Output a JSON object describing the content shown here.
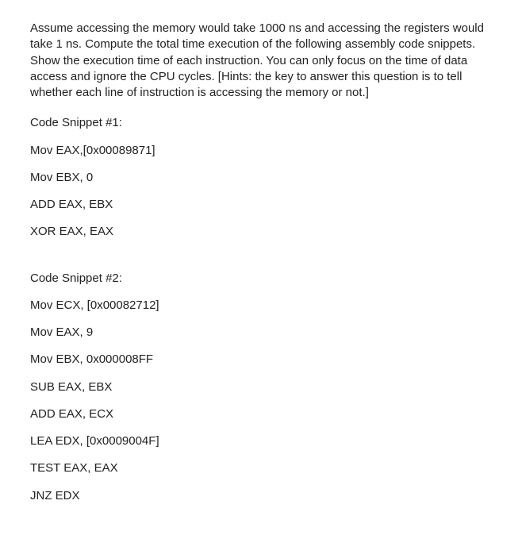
{
  "description": "Assume accessing the memory would take 1000 ns and accessing the registers would take 1 ns. Compute the total time execution of the following assembly code snippets. Show the execution time of each instruction. You can only focus on the time of data access and ignore the CPU cycles. [Hints: the key to answer this question is to tell whether each line of instruction is accessing the memory or not.]",
  "snippet1": {
    "title": "Code Snippet #1:",
    "lines": [
      "Mov EAX,[0x00089871]",
      "Mov EBX, 0",
      "ADD EAX, EBX",
      "XOR EAX, EAX"
    ]
  },
  "snippet2": {
    "title": "Code Snippet #2:",
    "lines": [
      "Mov ECX, [0x00082712]",
      "Mov EAX, 9",
      "Mov EBX, 0x000008FF",
      "SUB EAX, EBX",
      "ADD EAX, ECX",
      "LEA EDX, [0x0009004F]",
      "TEST EAX, EAX",
      "JNZ EDX"
    ]
  }
}
